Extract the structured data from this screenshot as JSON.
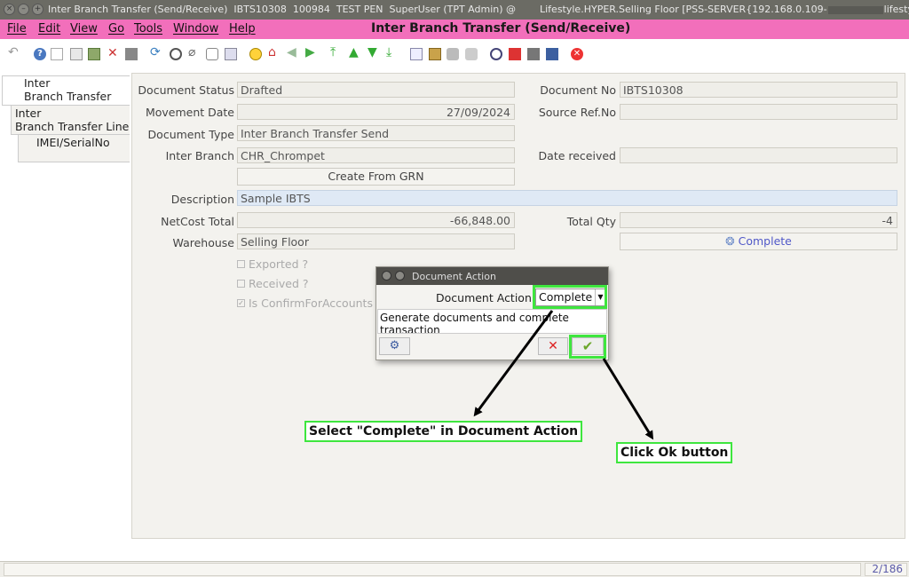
{
  "titlebar": {
    "text": "Inter Branch Transfer (Send/Receive)  IBTS10308  100984  TEST PEN  SuperUser (TPT Admin) @",
    "right_text_a": "Lifestyle.HYPER.Selling Floor [PSS-SERVER{192.168.0.109-",
    "right_text_b": "lifestyle-s"
  },
  "menubar": {
    "items": [
      "File",
      "Edit",
      "View",
      "Go",
      "Tools",
      "Window",
      "Help"
    ],
    "window_title": "Inter Branch Transfer (Send/Receive)",
    "background": "#f26fbb"
  },
  "tabs": [
    {
      "label_line1": "Inter",
      "label_line2": "Branch Transfer"
    },
    {
      "label_line1": "Inter",
      "label_line2": "Branch Transfer Line"
    },
    {
      "label_line1": "IMEI/SerialNo",
      "label_line2": ""
    }
  ],
  "form": {
    "document_status": {
      "label": "Document Status",
      "value": "Drafted"
    },
    "document_no": {
      "label": "Document No",
      "value": "IBTS10308"
    },
    "movement_date": {
      "label": "Movement Date",
      "value": "27/09/2024"
    },
    "source_ref_no": {
      "label": "Source Ref.No",
      "value": ""
    },
    "document_type": {
      "label": "Document Type",
      "value": "Inter Branch Transfer Send"
    },
    "inter_branch": {
      "label": "Inter Branch",
      "value": "CHR_Chrompet"
    },
    "date_received": {
      "label": "Date received",
      "value": ""
    },
    "create_from_grn": "Create From GRN",
    "description": {
      "label": "Description",
      "value": "Sample IBTS"
    },
    "netcost_total": {
      "label": "NetCost Total",
      "value": "-66,848.00"
    },
    "total_qty": {
      "label": "Total Qty",
      "value": "-4"
    },
    "warehouse": {
      "label": "Warehouse",
      "value": "Selling Floor"
    },
    "complete_button": "Complete",
    "exported": "Exported ?",
    "received": "Received ?",
    "is_confirm": "Is ConfirmForAccounts"
  },
  "dialog": {
    "title": "Document Action",
    "action_label": "Document Action",
    "action_value": "Complete",
    "description": "Generate documents and complete transaction"
  },
  "callouts": {
    "select_complete": "Select \"Complete\" in Document Action",
    "click_ok": "Click Ok button"
  },
  "status": {
    "record_count": "2/186"
  }
}
